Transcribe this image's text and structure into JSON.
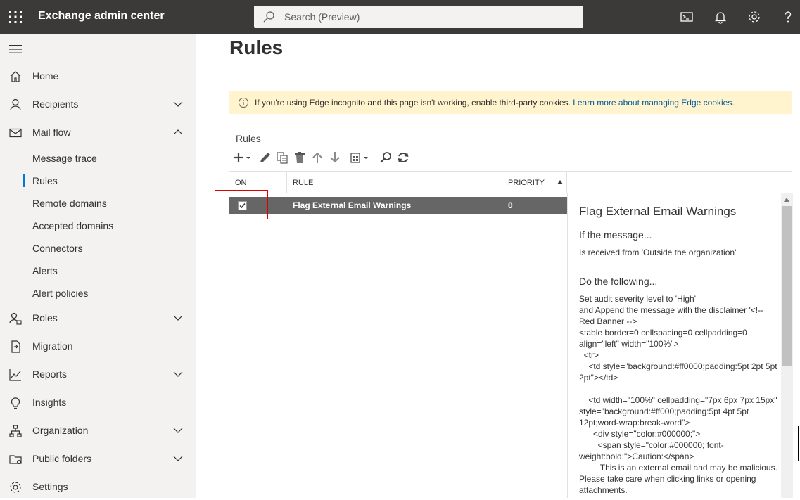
{
  "header": {
    "app_title": "Exchange admin center",
    "search_placeholder": "Search (Preview)",
    "icons": [
      "waffle-icon",
      "search-icon",
      "terminal-icon",
      "bell-icon",
      "gear-icon",
      "help-icon"
    ]
  },
  "nav": {
    "items": [
      {
        "label": "Home",
        "icon": "home-icon"
      },
      {
        "label": "Recipients",
        "icon": "person-icon",
        "expandable": true
      },
      {
        "label": "Mail flow",
        "icon": "mail-icon",
        "expanded": true
      },
      {
        "label": "Roles",
        "icon": "roles-icon",
        "expandable": true
      },
      {
        "label": "Migration",
        "icon": "migration-icon"
      },
      {
        "label": "Reports",
        "icon": "chart-icon",
        "expandable": true
      },
      {
        "label": "Insights",
        "icon": "lightbulb-icon"
      },
      {
        "label": "Organization",
        "icon": "org-icon",
        "expandable": true
      },
      {
        "label": "Public folders",
        "icon": "folder-icon",
        "expandable": true
      },
      {
        "label": "Settings",
        "icon": "gear-icon"
      }
    ],
    "mail_flow_sub": [
      {
        "label": "Message trace"
      },
      {
        "label": "Rules",
        "active": true
      },
      {
        "label": "Remote domains"
      },
      {
        "label": "Accepted domains"
      },
      {
        "label": "Connectors"
      },
      {
        "label": "Alerts"
      },
      {
        "label": "Alert policies"
      }
    ]
  },
  "main": {
    "title": "Rules",
    "banner": {
      "text": "If you're using Edge incognito and this page isn't working, enable third-party cookies.",
      "link": "Learn more about managing Edge cookies."
    },
    "section_label": "Rules",
    "columns": {
      "on": "ON",
      "rule": "RULE",
      "priority": "PRIORITY"
    },
    "rows": [
      {
        "on": true,
        "rule": "Flag External Email Warnings",
        "priority": "0"
      }
    ]
  },
  "details": {
    "title": "Flag External Email Warnings",
    "if_heading": "If the message...",
    "if_text": "Is received from 'Outside the organization'",
    "do_heading": "Do the following...",
    "do_lines": [
      "Set audit severity level to 'High'",
      "and Append the message with the disclaimer '<!--",
      "Red Banner -->",
      "<table border=0 cellspacing=0 cellpadding=0",
      "align=\"left\" width=\"100%\">",
      "  <tr>",
      "    <td style=\"background:#ff0000;padding:5pt 2pt 5pt",
      "2pt\"></td>",
      "",
      "    <td width=\"100%\" cellpadding=\"7px 6px 7px 15px\"",
      "style=\"background:#ff000;padding:5pt 4pt 5pt",
      "12pt;word-wrap:break-word\">",
      "      <div style=\"color:#000000;\">",
      "        <span style=\"color:#000000; font-",
      "weight:bold;\">Caution:</span>",
      "         This is an external email and may be malicious.",
      "Please take care when clicking links or opening",
      "attachments."
    ]
  },
  "colors": {
    "topbar": "#3b3a39",
    "nav_bg": "#f3f2f1",
    "accent": "#0078d4",
    "banner_bg": "#fff4ce",
    "selected_row": "#666666",
    "highlight": "#e00000"
  }
}
